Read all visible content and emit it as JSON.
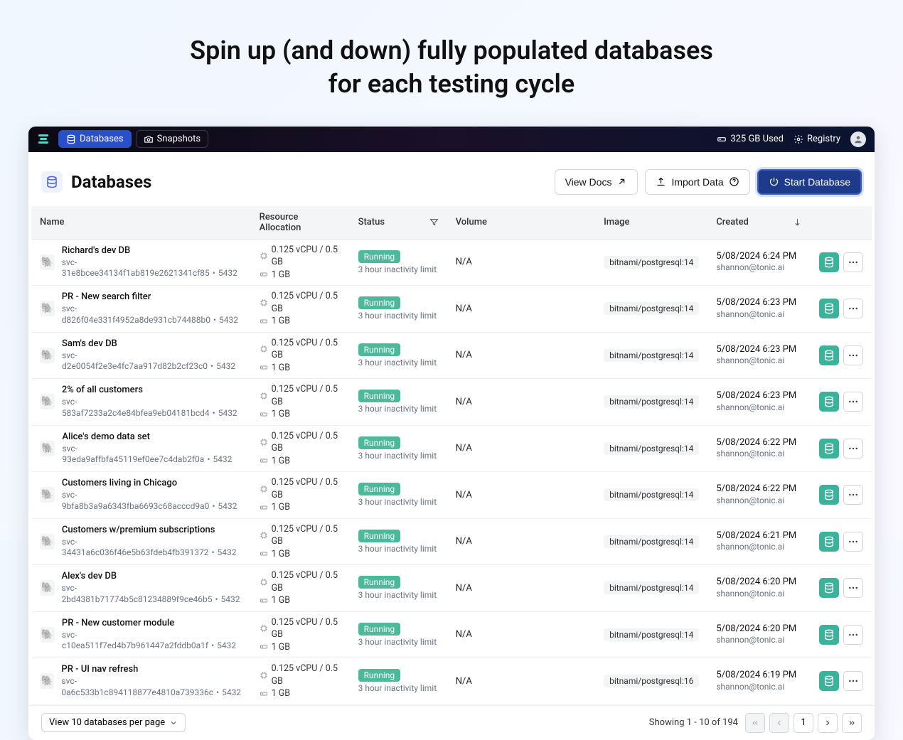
{
  "hero": {
    "line1": "Spin up (and down) fully populated databases",
    "line2": "for each testing cycle"
  },
  "topbar": {
    "databases": "Databases",
    "snapshots": "Snapshots",
    "storage": "325 GB Used",
    "registry": "Registry"
  },
  "page": {
    "title": "Databases",
    "view_docs": "View Docs",
    "import_data": "Import Data",
    "start_database": "Start Database"
  },
  "columns": {
    "name": "Name",
    "resource": "Resource Allocation",
    "status": "Status",
    "volume": "Volume",
    "image": "Image",
    "created": "Created"
  },
  "rows": [
    {
      "name": "Richard's dev DB",
      "svc": "svc-31e8bcee34134f1ab819e2621341cf85",
      "port": "5432",
      "cpu": "0.125 vCPU / 0.5 GB",
      "disk": "1 GB",
      "status": "Running",
      "status_sub": "3 hour inactivity limit",
      "volume": "N/A",
      "image": "bitnami/postgresql:14",
      "created": "5/08/2024 6:24 PM",
      "creator": "shannon@tonic.ai"
    },
    {
      "name": "PR - New search filter",
      "svc": "svc-d826f04e331f4952a8de931cb74488b0",
      "port": "5432",
      "cpu": "0.125 vCPU / 0.5 GB",
      "disk": "1 GB",
      "status": "Running",
      "status_sub": "3 hour inactivity limit",
      "volume": "N/A",
      "image": "bitnami/postgresql:14",
      "created": "5/08/2024 6:23 PM",
      "creator": "shannon@tonic.ai"
    },
    {
      "name": "Sam's dev DB",
      "svc": "svc-d2e0054f2e3e4fc7aa917d82b2cf23c0",
      "port": "5432",
      "cpu": "0.125 vCPU / 0.5 GB",
      "disk": "1 GB",
      "status": "Running",
      "status_sub": "3 hour inactivity limit",
      "volume": "N/A",
      "image": "bitnami/postgresql:14",
      "created": "5/08/2024 6:23 PM",
      "creator": "shannon@tonic.ai"
    },
    {
      "name": "2% of all customers",
      "svc": "svc-583af7233a2c4e84bfea9eb04181bcd4",
      "port": "5432",
      "cpu": "0.125 vCPU / 0.5 GB",
      "disk": "1 GB",
      "status": "Running",
      "status_sub": "3 hour inactivity limit",
      "volume": "N/A",
      "image": "bitnami/postgresql:14",
      "created": "5/08/2024 6:23 PM",
      "creator": "shannon@tonic.ai"
    },
    {
      "name": "Alice's demo data set",
      "svc": "svc-93eda9affbfa45119ef0ee7c4dab2f0a",
      "port": "5432",
      "cpu": "0.125 vCPU / 0.5 GB",
      "disk": "1 GB",
      "status": "Running",
      "status_sub": "3 hour inactivity limit",
      "volume": "N/A",
      "image": "bitnami/postgresql:14",
      "created": "5/08/2024 6:22 PM",
      "creator": "shannon@tonic.ai"
    },
    {
      "name": "Customers living in Chicago",
      "svc": "svc-9bfa8b3a9a6343fba6693c68acccd9a0",
      "port": "5432",
      "cpu": "0.125 vCPU / 0.5 GB",
      "disk": "1 GB",
      "status": "Running",
      "status_sub": "3 hour inactivity limit",
      "volume": "N/A",
      "image": "bitnami/postgresql:14",
      "created": "5/08/2024 6:22 PM",
      "creator": "shannon@tonic.ai"
    },
    {
      "name": "Customers w/premium subscriptions",
      "svc": "svc-34431a6c036f46e5b63fdeb4fb391372",
      "port": "5432",
      "cpu": "0.125 vCPU / 0.5 GB",
      "disk": "1 GB",
      "status": "Running",
      "status_sub": "3 hour inactivity limit",
      "volume": "N/A",
      "image": "bitnami/postgresql:14",
      "created": "5/08/2024 6:21 PM",
      "creator": "shannon@tonic.ai"
    },
    {
      "name": "Alex's dev DB",
      "svc": "svc-2bd4381b71774b5c81234889f9ce46b5",
      "port": "5432",
      "cpu": "0.125 vCPU / 0.5 GB",
      "disk": "1 GB",
      "status": "Running",
      "status_sub": "3 hour inactivity limit",
      "volume": "N/A",
      "image": "bitnami/postgresql:14",
      "created": "5/08/2024 6:20 PM",
      "creator": "shannon@tonic.ai"
    },
    {
      "name": "PR - New customer module",
      "svc": "svc-c10ea511f7ed4b7b961447a2fddb0a1f",
      "port": "5432",
      "cpu": "0.125 vCPU / 0.5 GB",
      "disk": "1 GB",
      "status": "Running",
      "status_sub": "3 hour inactivity limit",
      "volume": "N/A",
      "image": "bitnami/postgresql:14",
      "created": "5/08/2024 6:20 PM",
      "creator": "shannon@tonic.ai"
    },
    {
      "name": "PR - UI nav refresh",
      "svc": "svc-0a6c533b1c894118877e4810a739336c",
      "port": "5432",
      "cpu": "0.125 vCPU / 0.5 GB",
      "disk": "1 GB",
      "status": "Running",
      "status_sub": "3 hour inactivity limit",
      "volume": "N/A",
      "image": "bitnami/postgresql:16",
      "created": "5/08/2024 6:19 PM",
      "creator": "shannon@tonic.ai"
    }
  ],
  "footer": {
    "per_page": "View 10 databases per page",
    "showing": "Showing 1 - 10 of 194",
    "current_page": "1"
  }
}
